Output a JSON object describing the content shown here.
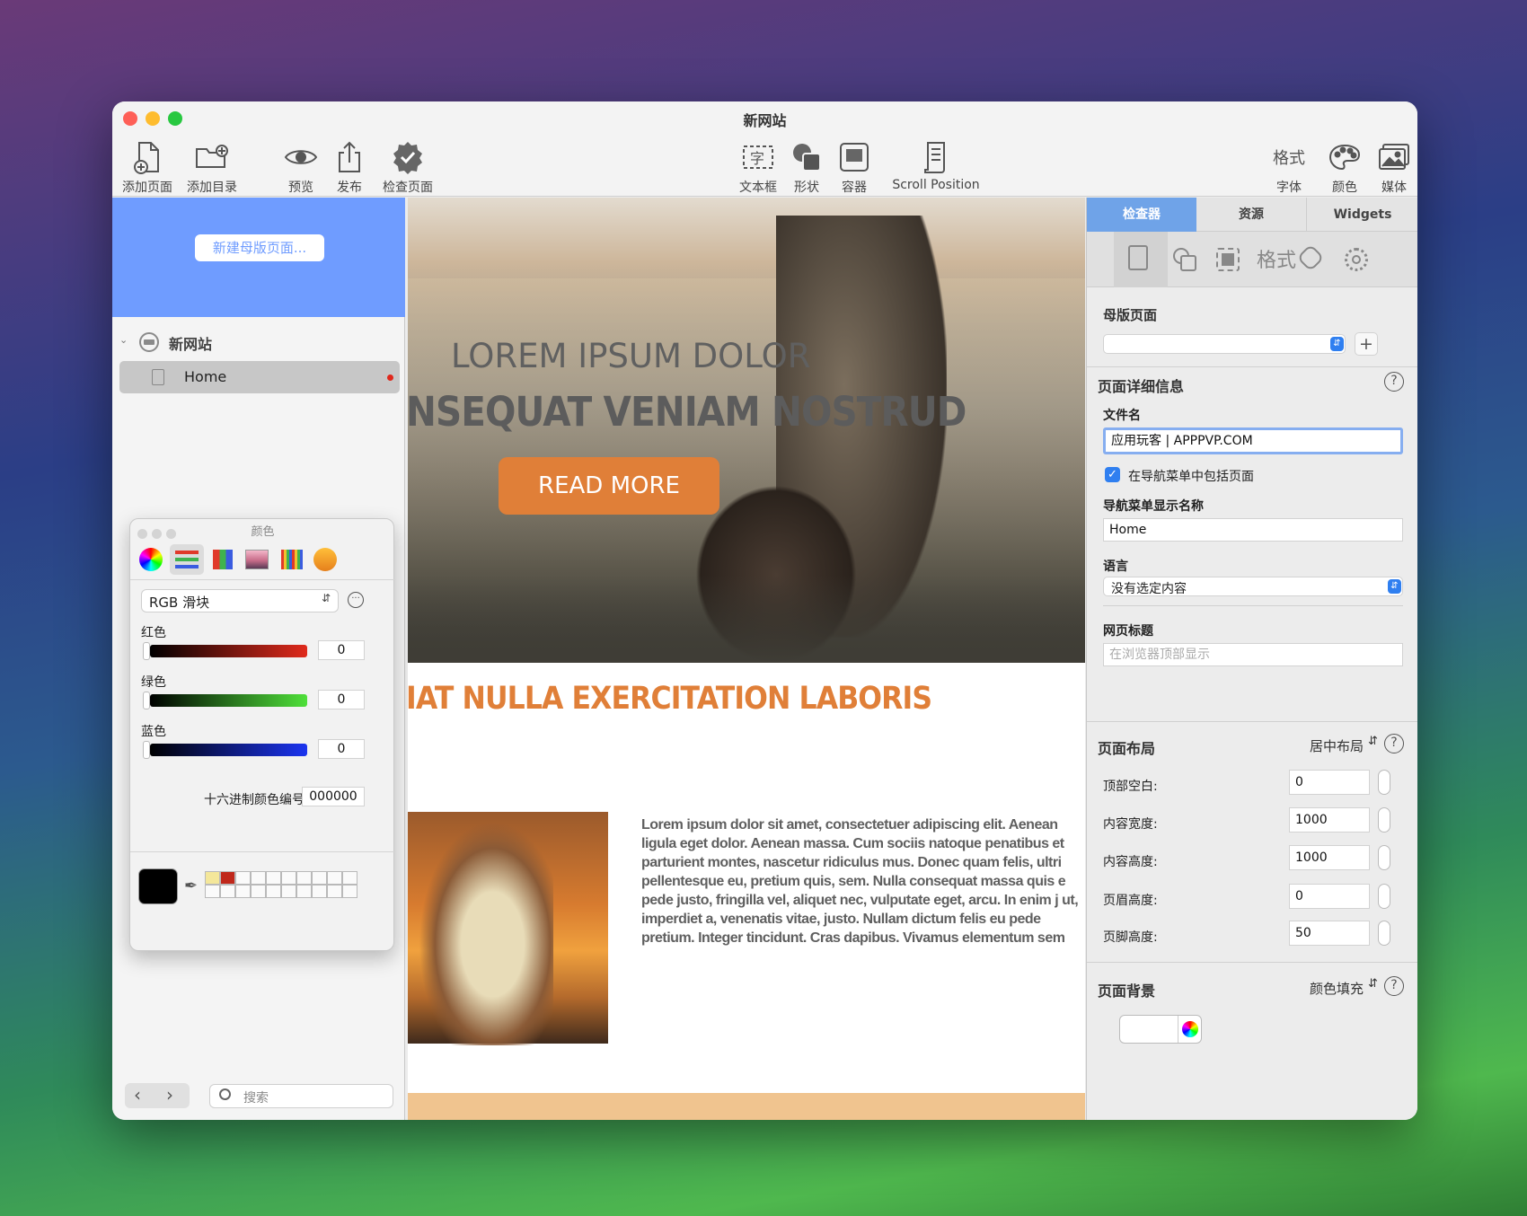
{
  "window": {
    "title": "新网站"
  },
  "toolbar": {
    "left": [
      {
        "label": "添加页面",
        "icon": "add-page-icon"
      },
      {
        "label": "添加目录",
        "icon": "add-folder-icon"
      },
      {
        "label": "预览",
        "icon": "eye-icon"
      },
      {
        "label": "发布",
        "icon": "share-icon"
      },
      {
        "label": "检查页面",
        "icon": "checkmark-badge-icon"
      }
    ],
    "center": [
      {
        "label": "文本框",
        "icon": "textbox-icon"
      },
      {
        "label": "形状",
        "icon": "shapes-icon"
      },
      {
        "label": "容器",
        "icon": "container-icon"
      },
      {
        "label": "Scroll Position",
        "icon": "scroll-icon"
      }
    ],
    "right": [
      {
        "label": "字体",
        "icon": "format-text-icon",
        "icon_text": "格式"
      },
      {
        "label": "颜色",
        "icon": "palette-icon"
      },
      {
        "label": "媒体",
        "icon": "media-icon"
      }
    ]
  },
  "sidebar": {
    "master_button": "新建母版页面...",
    "site_name": "新网站",
    "pages": [
      {
        "label": "Home"
      }
    ],
    "search_placeholder": "搜索"
  },
  "color_panel": {
    "title": "颜色",
    "mode": "RGB 滑块",
    "sliders": [
      {
        "label": "红色",
        "value": "0",
        "color": "#e02a1c"
      },
      {
        "label": "绿色",
        "value": "0",
        "color": "#4fe03a"
      },
      {
        "label": "蓝色",
        "value": "0",
        "color": "#1b34f0"
      }
    ],
    "hex_label": "十六进制颜色编号",
    "hex_value": "000000",
    "current_color": "#000000",
    "swatches": [
      "#f4e79a",
      "#c0281b"
    ]
  },
  "canvas": {
    "hero_line1": "LOREM IPSUM DOLOR",
    "hero_line2": "NSEQUAT VENIAM NOSTRUD",
    "button": "READ MORE",
    "heading": "IAT NULLA EXERCITATION LABORIS",
    "body_text": "Lorem ipsum dolor sit amet, consectetuer adipiscing elit. Aenean ligula eget dolor. Aenean massa. Cum sociis natoque penatibus et parturient montes, nascetur ridiculus mus. Donec quam felis, ultri pellentesque eu, pretium quis, sem. Nulla consequat massa quis e pede justo, fringilla vel, aliquet nec, vulputate eget, arcu. In enim j ut, imperdiet a, venenatis vitae, justo. Nullam dictum felis eu pede pretium. Integer tincidunt. Cras dapibus. Vivamus elementum sem",
    "accent_color": "#e07f38"
  },
  "inspector": {
    "tabs": [
      {
        "label": "检查器",
        "active": true
      },
      {
        "label": "资源"
      },
      {
        "label": "Widgets"
      }
    ],
    "icon_row_text": "格式",
    "master_label": "母版页面",
    "page_details": "页面详细信息",
    "filename_label": "文件名",
    "filename_value": "应用玩客 | APPPVP.COM",
    "include_nav": "在导航菜单中包括页面",
    "nav_name_label": "导航菜单显示名称",
    "nav_name_value": "Home",
    "language_label": "语言",
    "language_value": "没有选定内容",
    "webtitle_label": "网页标题",
    "webtitle_placeholder": "在浏览器顶部显示",
    "layout_label": "页面布局",
    "layout_value": "居中布局",
    "layout_fields": [
      {
        "label": "顶部空白:",
        "value": "0"
      },
      {
        "label": "内容宽度:",
        "value": "1000"
      },
      {
        "label": "内容高度:",
        "value": "1000"
      },
      {
        "label": "页眉高度:",
        "value": "0"
      },
      {
        "label": "页脚高度:",
        "value": "50"
      }
    ],
    "background_label": "页面背景",
    "background_value": "颜色填充"
  }
}
